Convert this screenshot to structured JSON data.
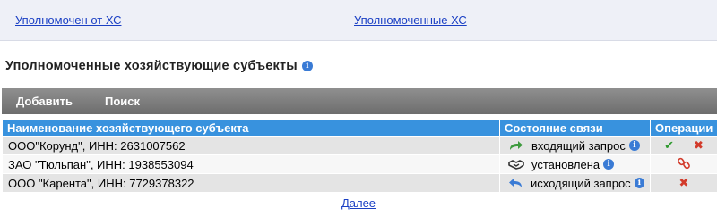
{
  "top_links": {
    "from": "Уполномочен от ХС",
    "to": "Уполномоченные ХС"
  },
  "heading": {
    "title": "Уполномоченные хозяйствующие субъекты",
    "info_glyph": "i"
  },
  "toolbar": {
    "add_label": "Добавить",
    "search_label": "Поиск"
  },
  "table": {
    "columns": [
      "Наименование хозяйствующего субъекта",
      "Состояние связи",
      "Операции"
    ],
    "rows": [
      {
        "name": "ООО\"Корунд\", ИНН: 2631007562",
        "status": "входящий запрос",
        "status_icon": "incoming-arrow-icon",
        "ops": [
          "accept-check-icon",
          "reject-x-icon"
        ]
      },
      {
        "name": "ЗАО \"Тюльпан\", ИНН: 1938553094",
        "status": "установлена",
        "status_icon": "handshake-icon",
        "ops": [
          "unlink-chain-icon"
        ]
      },
      {
        "name": "ООО \"Карента\", ИНН: 7729378322",
        "status": "исходящий запрос",
        "status_icon": "outgoing-return-arrow-icon",
        "ops": [
          "cancel-x-icon"
        ]
      }
    ],
    "glyphs": {
      "check": "✔",
      "cross": "✖"
    }
  },
  "pagination": {
    "next_label": "Далее"
  },
  "colors": {
    "header_bg": "#3892de",
    "toolbar_bg": "#7d7d7d",
    "link": "#1a3fc4",
    "accept": "#2e9a2e",
    "reject": "#d23a2a"
  }
}
